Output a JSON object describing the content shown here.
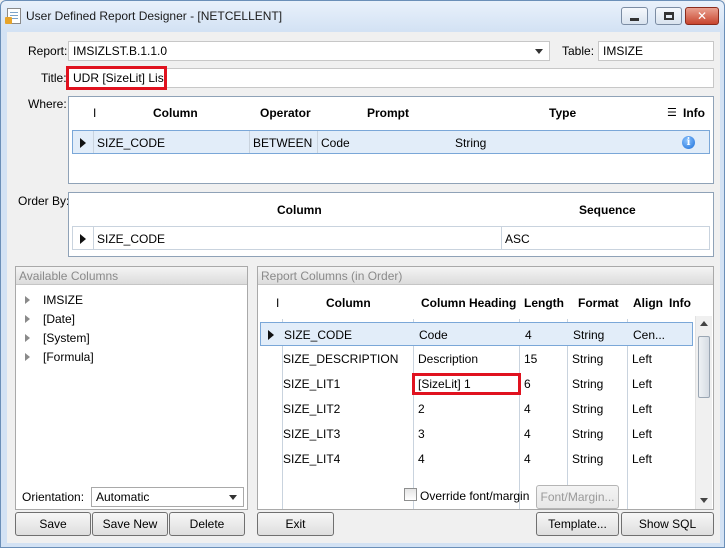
{
  "window": {
    "title": "User Defined Report Designer - [NETCELLENT]",
    "minimize_glyph": "",
    "close_glyph": "✕"
  },
  "report": {
    "label": "Report:",
    "value": "IMSIZLST.B.1.1.0"
  },
  "table": {
    "label": "Table:",
    "value": "IMSIZE"
  },
  "title_field": {
    "label": "Title:",
    "value": "UDR [SizeLit] List"
  },
  "where": {
    "label": "Where:",
    "headers": {
      "indicator": "I",
      "column": "Column",
      "operator": "Operator",
      "prompt": "Prompt",
      "type": "Type",
      "info": "Info"
    },
    "rows": [
      {
        "column": "SIZE_CODE",
        "operator": "BETWEEN",
        "prompt": "Code",
        "type": "String",
        "info_icon": "info-icon"
      }
    ]
  },
  "order_by": {
    "label": "Order By:",
    "headers": {
      "column": "Column",
      "sequence": "Sequence"
    },
    "rows": [
      {
        "column": "SIZE_CODE",
        "sequence": "ASC"
      }
    ]
  },
  "available_columns": {
    "title": "Available Columns",
    "items": [
      "IMSIZE",
      "[Date]",
      "[System]",
      "[Formula]"
    ]
  },
  "report_columns": {
    "title": "Report Columns (in Order)",
    "headers": {
      "indicator": "I",
      "column": "Column",
      "heading": "Column Heading",
      "length": "Length",
      "format": "Format",
      "align": "Align",
      "info": "Info"
    },
    "rows": [
      {
        "column": "SIZE_CODE",
        "heading": "Code",
        "length": "4",
        "format": "String",
        "align": "Cen..."
      },
      {
        "column": "SIZE_DESCRIPTION",
        "heading": "Description",
        "length": "15",
        "format": "String",
        "align": "Left"
      },
      {
        "column": "SIZE_LIT1",
        "heading": "[SizeLit] 1",
        "length": "6",
        "format": "String",
        "align": "Left"
      },
      {
        "column": "SIZE_LIT2",
        "heading": "2",
        "length": "4",
        "format": "String",
        "align": "Left"
      },
      {
        "column": "SIZE_LIT3",
        "heading": "3",
        "length": "4",
        "format": "String",
        "align": "Left"
      },
      {
        "column": "SIZE_LIT4",
        "heading": "4",
        "length": "4",
        "format": "String",
        "align": "Left"
      }
    ]
  },
  "orientation": {
    "label": "Orientation:",
    "value": "Automatic"
  },
  "override": {
    "label": "Override font/margin"
  },
  "buttons": {
    "save": "Save",
    "save_new": "Save New",
    "delete": "Delete",
    "exit": "Exit",
    "font_margin": "Font/Margin...",
    "template": "Template...",
    "show_sql": "Show SQL"
  },
  "colors": {
    "highlight_red": "#e0121f",
    "selected_row": "#e2edf9"
  }
}
